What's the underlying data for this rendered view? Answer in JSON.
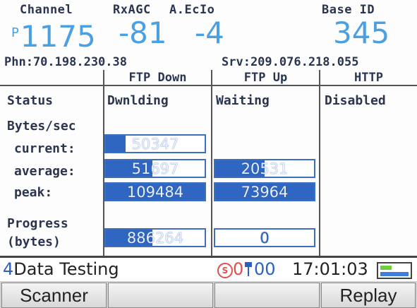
{
  "header": {
    "channel_label": "Channel",
    "rxagc_label": "RxAGC",
    "ecio_label": "A.EcIo",
    "baseid_label": "Base ID",
    "channel_prefix": "P",
    "channel_value": "1175",
    "rxagc_value": "-81",
    "ecio_value": "-4",
    "baseid_value": "345",
    "phone_address": "Phn:70.198.230.38",
    "server_address": "Srv:209.076.218.055"
  },
  "table": {
    "columns": [
      "FTP Down",
      "FTP Up",
      "HTTP"
    ],
    "status_label": "Status",
    "status_values": [
      "Dwnlding",
      "Waiting",
      "Disabled"
    ],
    "bytes_label": "Bytes/sec",
    "current_label": "current:",
    "average_label": "average:",
    "peak_label": "peak:",
    "progress_label_1": "Progress",
    "progress_label_2": "(bytes)",
    "ftp_down": {
      "current": {
        "value": "50347",
        "fill": 0.2
      },
      "average": {
        "value": "51697",
        "fill": 0.47
      },
      "peak": {
        "value": "109484",
        "fill": 1.0
      },
      "progress": {
        "value": "886264",
        "fill": 0.47
      }
    },
    "ftp_up": {
      "average": {
        "value": "20531",
        "fill": 0.5
      },
      "peak": {
        "value": "73964",
        "fill": 1.0
      },
      "progress": {
        "value": "0",
        "fill": 0.0
      }
    }
  },
  "status_bar": {
    "app_number": "4",
    "app_name": "Data Testing",
    "s_icon": "S",
    "count_a": "0",
    "count_b": "00",
    "time": "17:01:03",
    "colors": {
      "count_a": "#e0504a",
      "count_b": "#2a5fc4"
    }
  },
  "softkeys": [
    "Scanner",
    "",
    "",
    "Replay"
  ]
}
